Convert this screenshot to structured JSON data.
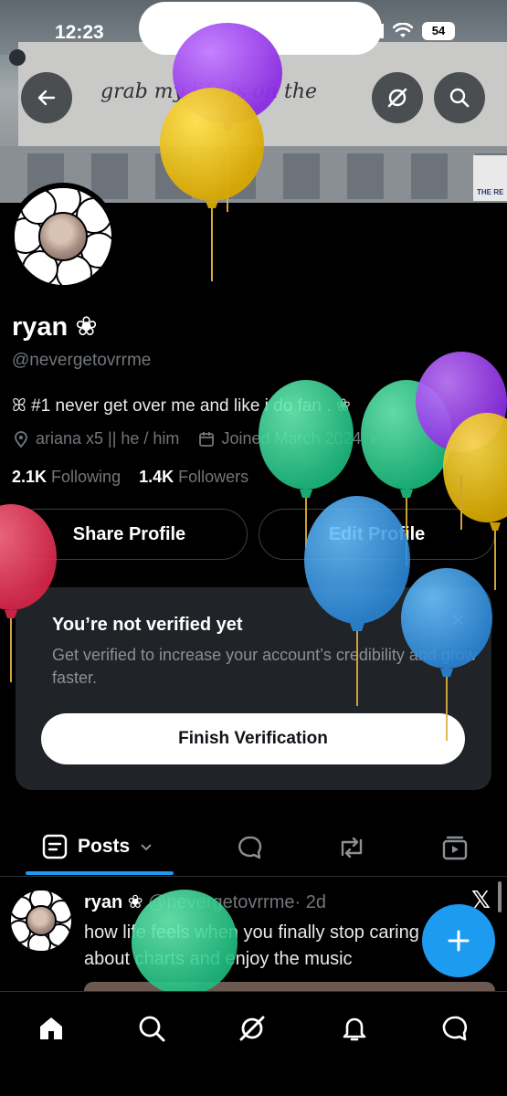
{
  "status_bar": {
    "time": "12:23",
    "battery": "54"
  },
  "banner": {
    "billboard_text": "grab    my life is on the",
    "sign_text": "THE RE"
  },
  "profile": {
    "name": "ryan ❀",
    "handle": "@nevergetovrrme",
    "bio": "ꕤ #1 never get over me and like i do fan . ❀",
    "location": "ariana x5 || he / him",
    "joined": "Joined March 2024",
    "following_count": "2.1K",
    "following_label": "Following",
    "followers_count": "1.4K",
    "followers_label": "Followers"
  },
  "buttons": {
    "share": "Share Profile",
    "edit": "Edit Profile"
  },
  "verification": {
    "title": "You’re not verified yet",
    "body": "Get verified to increase your account’s credibility and grow faster.",
    "button": "Finish Verification"
  },
  "tabs": {
    "posts": "Posts"
  },
  "post": {
    "name": "ryan ❀",
    "handle": "@nevergetovrrme",
    "age": "· 2d",
    "text": "how life feels when you finally stop caring about charts and enjoy the music"
  },
  "icons": [
    "back-arrow-icon",
    "grok-icon",
    "search-icon",
    "location-pin-icon",
    "calendar-icon",
    "chevron-down-icon",
    "reply-icon",
    "repost-icon",
    "media-icon",
    "home-icon",
    "grok-icon",
    "bell-icon",
    "message-icon",
    "plus-icon",
    "x-logo-icon"
  ],
  "colors": {
    "accent": "#1d9bf0",
    "card": "#202327",
    "muted": "#71767b"
  }
}
